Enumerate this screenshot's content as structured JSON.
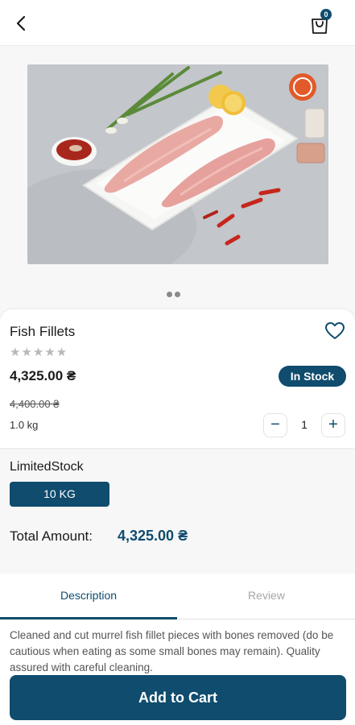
{
  "header": {
    "back_icon": "back-arrow-icon",
    "cart_icon": "shopping-bag-icon",
    "cart_count": "0"
  },
  "gallery": {
    "image_alt": "Fish fillets on white plate",
    "dot_count": 2
  },
  "product": {
    "name": "Fish Fillets",
    "rating_stars": "★★★★★",
    "rating": 0,
    "price": "4,325.00 ₴",
    "stock_status": "In Stock",
    "old_price": "4,400.00 ₴",
    "weight": "1.0 kg",
    "quantity": "1",
    "minus_label": "−",
    "plus_label": "+"
  },
  "variant": {
    "title": "LimitedStock",
    "selected": "10 KG"
  },
  "total": {
    "label": "Total Amount:",
    "value": "4,325.00 ₴"
  },
  "tabs": [
    {
      "label": "Description",
      "active": true
    },
    {
      "label": "Review",
      "active": false
    }
  ],
  "description": "Cleaned and cut murrel fish fillet pieces with bones removed (do be cautious when eating as some small bones may remain). Quality assured with careful cleaning.",
  "cta": {
    "label": "Add to Cart"
  },
  "colors": {
    "primary": "#0f4c6e",
    "background": "#f7f7f7",
    "star_inactive": "#b8b8b8"
  }
}
